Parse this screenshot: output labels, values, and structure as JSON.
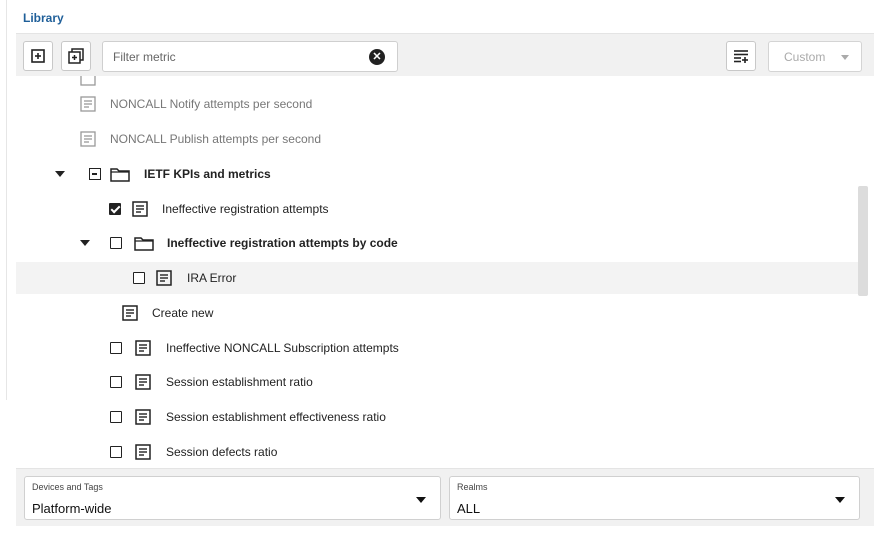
{
  "library": {
    "title": "Library"
  },
  "toolbar": {
    "search": {
      "placeholder": "Filter metric",
      "value": ""
    },
    "custom": {
      "label": "Custom"
    }
  },
  "tree": {
    "items": [
      {
        "label": "NONCALL Notify attempts per second",
        "muted": true
      },
      {
        "label": "NONCALL Publish attempts per second",
        "muted": true
      },
      {
        "label": "IETF KPIs and metrics",
        "bold": true
      },
      {
        "label": "Ineffective registration attempts",
        "checked": true
      },
      {
        "label": "Ineffective registration attempts by code",
        "bold": true
      },
      {
        "label": "IRA Error",
        "selected": true
      },
      {
        "label": "Create new"
      },
      {
        "label": "Ineffective NONCALL Subscription attempts"
      },
      {
        "label": "Session establishment ratio"
      },
      {
        "label": "Session establishment effectiveness ratio"
      },
      {
        "label": "Session defects ratio"
      }
    ]
  },
  "footer": {
    "devices": {
      "label": "Devices and Tags",
      "value": "Platform-wide"
    },
    "realms": {
      "label": "Realms",
      "value": "ALL"
    }
  },
  "colors": {
    "accent": "#1f5f99",
    "toolbar_bg": "#f1f1f1",
    "selected_row": "#f3f3f3"
  }
}
